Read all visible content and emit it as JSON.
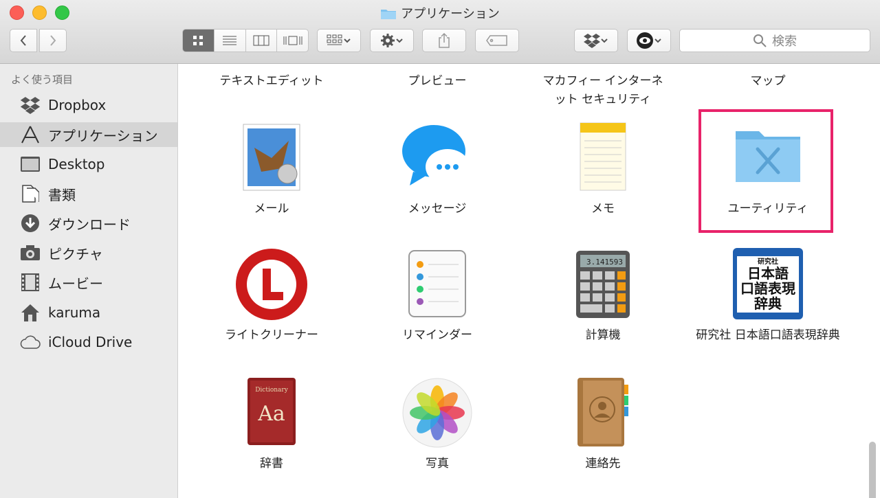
{
  "window": {
    "title": "アプリケーション"
  },
  "toolbar": {
    "search_placeholder": "検索"
  },
  "sidebar": {
    "heading": "よく使う項目",
    "items": [
      {
        "label": "Dropbox",
        "icon": "dropbox-icon"
      },
      {
        "label": "アプリケーション",
        "icon": "applications-icon",
        "selected": true
      },
      {
        "label": "Desktop",
        "icon": "desktop-icon"
      },
      {
        "label": "書類",
        "icon": "documents-icon"
      },
      {
        "label": "ダウンロード",
        "icon": "downloads-icon"
      },
      {
        "label": "ピクチャ",
        "icon": "camera-icon"
      },
      {
        "label": "ムービー",
        "icon": "film-icon"
      },
      {
        "label": "karuma",
        "icon": "home-icon"
      },
      {
        "label": "iCloud Drive",
        "icon": "cloud-icon"
      }
    ]
  },
  "content": {
    "top_labels": [
      "テキストエディット",
      "プレビュー",
      "マカフィー インターネット セキュリティ",
      "マップ"
    ],
    "apps": [
      {
        "label": "メール",
        "icon": "mail-icon"
      },
      {
        "label": "メッセージ",
        "icon": "messages-icon"
      },
      {
        "label": "メモ",
        "icon": "notes-icon"
      },
      {
        "label": "ユーティリティ",
        "icon": "utilities-folder-icon"
      },
      {
        "label": "ライトクリーナー",
        "icon": "light-cleaner-icon"
      },
      {
        "label": "リマインダー",
        "icon": "reminders-icon"
      },
      {
        "label": "計算機",
        "icon": "calculator-icon"
      },
      {
        "label": "研究社 日本語口語表現辞典",
        "icon": "kenkyusha-dictionary-icon"
      },
      {
        "label": "辞書",
        "icon": "dictionary-icon"
      },
      {
        "label": "写真",
        "icon": "photos-icon"
      },
      {
        "label": "連絡先",
        "icon": "contacts-icon"
      }
    ],
    "kenkyusha_icon_text": {
      "publisher": "研究社",
      "line1": "日本語",
      "line2": "口語表現",
      "line3": "辞典"
    },
    "dictionary_icon_text": {
      "small": "Dictionary",
      "big": "Aa"
    },
    "calculator_display": "3.141593"
  },
  "colors": {
    "highlight": "#e8236a",
    "selected_sidebar": "#d5d5d5"
  }
}
